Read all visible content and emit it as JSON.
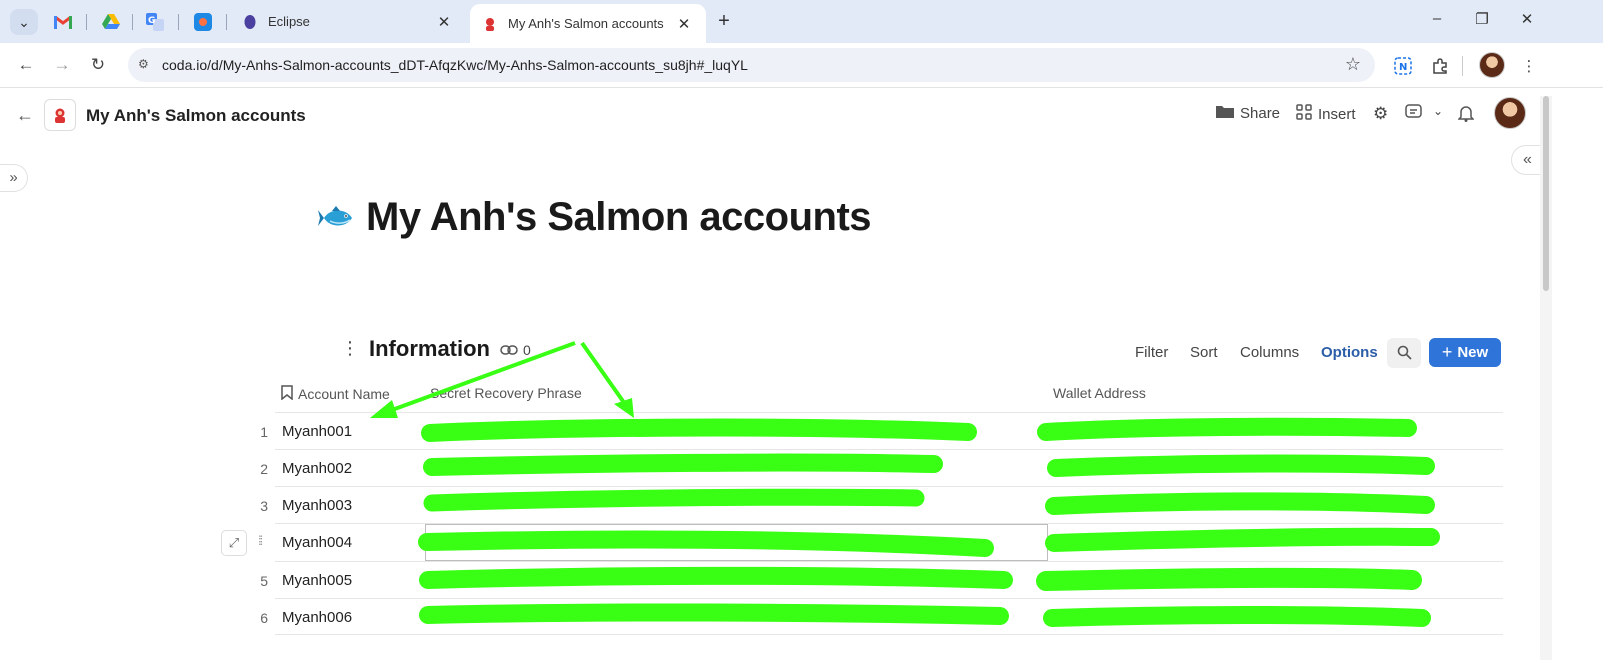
{
  "browser": {
    "tabs": [
      {
        "title": "Eclipse",
        "active": false
      },
      {
        "title": "My Anh's Salmon accounts",
        "active": true
      }
    ],
    "url": "coda.io/d/My-Anhs-Salmon-accounts_dDT-AfqzKwc/My-Anhs-Salmon-accounts_su8jh#_luqYL",
    "window_controls": [
      "–",
      "❐",
      "✕"
    ]
  },
  "doc": {
    "title": "My Anh's Salmon accounts",
    "header_actions": {
      "share": "Share",
      "insert": "Insert"
    }
  },
  "page": {
    "title": "My Anh's Salmon accounts"
  },
  "table": {
    "title": "Information",
    "link_count": "0",
    "actions": {
      "filter": "Filter",
      "sort": "Sort",
      "columns": "Columns",
      "options": "Options",
      "new": "New"
    },
    "columns": [
      "Account Name",
      "Secret Recovery Phrase",
      "Wallet Address"
    ],
    "rows": [
      {
        "num": "1",
        "name": "Myanh001",
        "phrase": "",
        "wallet": ""
      },
      {
        "num": "2",
        "name": "Myanh002",
        "phrase": "",
        "wallet": ""
      },
      {
        "num": "3",
        "name": "Myanh003",
        "phrase": "",
        "wallet": ""
      },
      {
        "num": "4",
        "name": "Myanh004",
        "phrase": "",
        "wallet": ""
      },
      {
        "num": "5",
        "name": "Myanh005",
        "phrase": "",
        "wallet": ""
      },
      {
        "num": "6",
        "name": "Myanh006",
        "phrase": "",
        "wallet": ""
      }
    ]
  },
  "colors": {
    "accent": "#2f74d9",
    "options_text": "#2c5ea8",
    "annotation": "#39ff14",
    "tabbar": "#e3eaf7"
  }
}
